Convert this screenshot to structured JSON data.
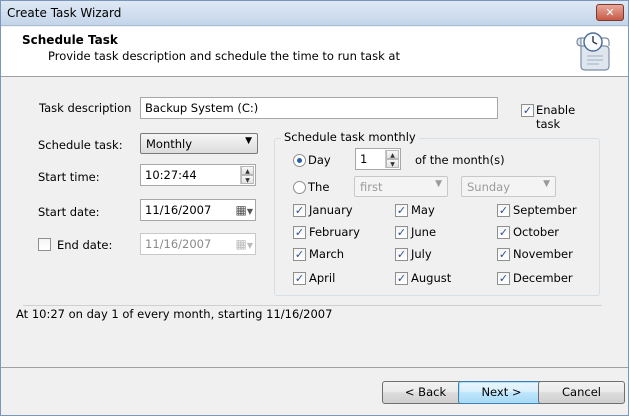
{
  "window": {
    "title": "Create Task Wizard",
    "close_glyph": "✕"
  },
  "header": {
    "title": "Schedule Task",
    "subtitle": "Provide task description and schedule the time to run task at",
    "icon": "scroll-clock-icon"
  },
  "form": {
    "task_description_label": "Task description",
    "task_description_value": "Backup System (C:)",
    "enable_task_label": "Enable task",
    "enable_task_checked": true,
    "schedule_task_label": "Schedule task:",
    "schedule_task_value": "Monthly",
    "start_time_label": "Start time:",
    "start_time_value": "10:27:44",
    "start_date_label": "Start date:",
    "start_date_value": "11/16/2007",
    "end_date_label": "End date:",
    "end_date_checked": false,
    "end_date_value": "11/16/2007"
  },
  "monthly": {
    "group_title": "Schedule task monthly",
    "day_label": "Day",
    "day_selected": true,
    "day_value": "1",
    "of_month_label": "of the month(s)",
    "the_label": "The",
    "ordinal_value": "first",
    "weekday_value": "Sunday",
    "months": [
      {
        "name": "January",
        "checked": true
      },
      {
        "name": "May",
        "checked": true
      },
      {
        "name": "September",
        "checked": true
      },
      {
        "name": "February",
        "checked": true
      },
      {
        "name": "June",
        "checked": true
      },
      {
        "name": "October",
        "checked": true
      },
      {
        "name": "March",
        "checked": true
      },
      {
        "name": "July",
        "checked": true
      },
      {
        "name": "November",
        "checked": true
      },
      {
        "name": "April",
        "checked": true
      },
      {
        "name": "August",
        "checked": true
      },
      {
        "name": "December",
        "checked": true
      }
    ]
  },
  "summary": "At 10:27 on day 1 of every month, starting 11/16/2007",
  "buttons": {
    "back": "< Back",
    "next": "Next >",
    "cancel": "Cancel"
  },
  "glyphs": {
    "check": "✓",
    "dropdown": "▼",
    "spin_up": "▲",
    "spin_down": "▼",
    "calendar": "▦"
  }
}
